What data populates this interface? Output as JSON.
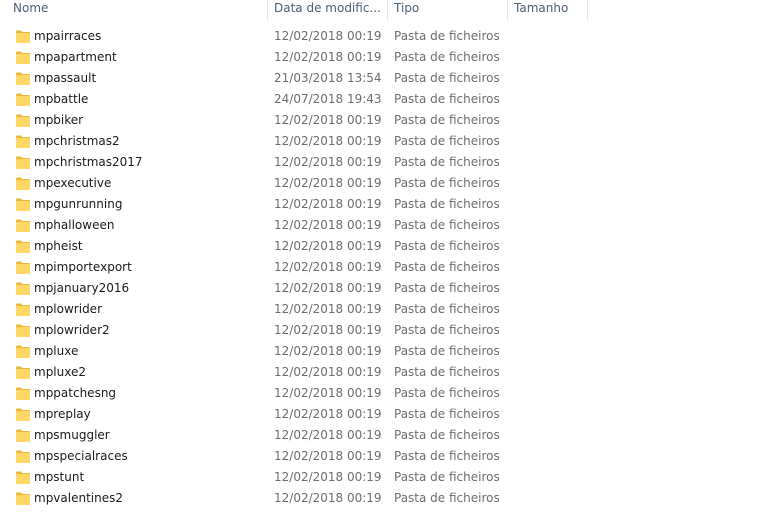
{
  "columns": {
    "name": "Nome",
    "date": "Data de modific...",
    "type": "Tipo",
    "size": "Tamanho"
  },
  "folder_color": "#FFD766",
  "folder_tab_color": "#E8B93C",
  "rows": [
    {
      "name": "mpairraces",
      "date": "12/02/2018 00:19",
      "type": "Pasta de ficheiros",
      "size": ""
    },
    {
      "name": "mpapartment",
      "date": "12/02/2018 00:19",
      "type": "Pasta de ficheiros",
      "size": ""
    },
    {
      "name": "mpassault",
      "date": "21/03/2018 13:54",
      "type": "Pasta de ficheiros",
      "size": ""
    },
    {
      "name": "mpbattle",
      "date": "24/07/2018 19:43",
      "type": "Pasta de ficheiros",
      "size": ""
    },
    {
      "name": "mpbiker",
      "date": "12/02/2018 00:19",
      "type": "Pasta de ficheiros",
      "size": ""
    },
    {
      "name": "mpchristmas2",
      "date": "12/02/2018 00:19",
      "type": "Pasta de ficheiros",
      "size": ""
    },
    {
      "name": "mpchristmas2017",
      "date": "12/02/2018 00:19",
      "type": "Pasta de ficheiros",
      "size": ""
    },
    {
      "name": "mpexecutive",
      "date": "12/02/2018 00:19",
      "type": "Pasta de ficheiros",
      "size": ""
    },
    {
      "name": "mpgunrunning",
      "date": "12/02/2018 00:19",
      "type": "Pasta de ficheiros",
      "size": ""
    },
    {
      "name": "mphalloween",
      "date": "12/02/2018 00:19",
      "type": "Pasta de ficheiros",
      "size": ""
    },
    {
      "name": "mpheist",
      "date": "12/02/2018 00:19",
      "type": "Pasta de ficheiros",
      "size": ""
    },
    {
      "name": "mpimportexport",
      "date": "12/02/2018 00:19",
      "type": "Pasta de ficheiros",
      "size": ""
    },
    {
      "name": "mpjanuary2016",
      "date": "12/02/2018 00:19",
      "type": "Pasta de ficheiros",
      "size": ""
    },
    {
      "name": "mplowrider",
      "date": "12/02/2018 00:19",
      "type": "Pasta de ficheiros",
      "size": ""
    },
    {
      "name": "mplowrider2",
      "date": "12/02/2018 00:19",
      "type": "Pasta de ficheiros",
      "size": ""
    },
    {
      "name": "mpluxe",
      "date": "12/02/2018 00:19",
      "type": "Pasta de ficheiros",
      "size": ""
    },
    {
      "name": "mpluxe2",
      "date": "12/02/2018 00:19",
      "type": "Pasta de ficheiros",
      "size": ""
    },
    {
      "name": "mppatchesng",
      "date": "12/02/2018 00:19",
      "type": "Pasta de ficheiros",
      "size": ""
    },
    {
      "name": "mpreplay",
      "date": "12/02/2018 00:19",
      "type": "Pasta de ficheiros",
      "size": ""
    },
    {
      "name": "mpsmuggler",
      "date": "12/02/2018 00:19",
      "type": "Pasta de ficheiros",
      "size": ""
    },
    {
      "name": "mpspecialraces",
      "date": "12/02/2018 00:19",
      "type": "Pasta de ficheiros",
      "size": ""
    },
    {
      "name": "mpstunt",
      "date": "12/02/2018 00:19",
      "type": "Pasta de ficheiros",
      "size": ""
    },
    {
      "name": "mpvalentines2",
      "date": "12/02/2018 00:19",
      "type": "Pasta de ficheiros",
      "size": ""
    }
  ]
}
